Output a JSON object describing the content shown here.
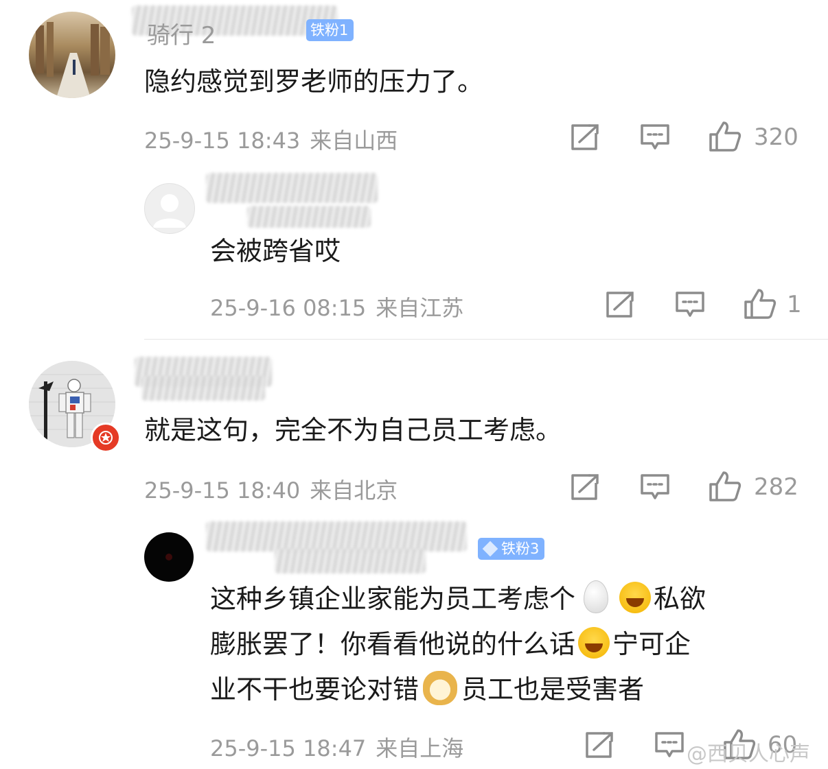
{
  "comments": [
    {
      "name_fragment": "骑行 2",
      "badge": "铁粉1",
      "text": "隐约感觉到罗老师的压力了。",
      "date": "25-9-15 18:43",
      "location": "来自山西",
      "likes": "320",
      "reply": {
        "text": "会被跨省哎",
        "date": "25-9-16 08:15",
        "location": "来自江苏",
        "likes": "1"
      }
    },
    {
      "text": "就是这句，完全不为自己员工考虑。",
      "date": "25-9-15 18:40",
      "location": "来自北京",
      "likes": "282",
      "reply": {
        "badge": "铁粉3",
        "line1_a": "这种乡镇企业家能为员工考虑个",
        "line1_b": "私欲",
        "line2_a": "膨胀罢了！你看看他说的什么话",
        "line2_b": "宁可企",
        "line3_a": "业不干也要论对错",
        "line3_b": "员工也是受害者",
        "date": "25-9-15 18:47",
        "location": "来自上海",
        "likes": "60"
      }
    }
  ],
  "watermark": "@西贝人心声",
  "icons": [
    "repost-icon",
    "comment-icon",
    "like-icon",
    "egg-emoji",
    "laugh-cry-emoji",
    "doge-emoji"
  ]
}
